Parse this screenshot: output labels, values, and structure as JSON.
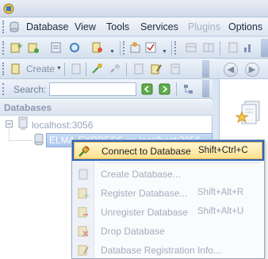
{
  "menubar": {
    "items": [
      {
        "label": "Database",
        "enabled": true
      },
      {
        "label": "View",
        "enabled": true
      },
      {
        "label": "Tools",
        "enabled": true
      },
      {
        "label": "Services",
        "enabled": true
      },
      {
        "label": "Plugins",
        "enabled": false
      },
      {
        "label": "Options",
        "enabled": true
      }
    ]
  },
  "toolbar": {
    "create_label": "Create",
    "search_label": "Search:",
    "search_value": ""
  },
  "databases_panel": {
    "header": "Databases",
    "server_node": "localhost:3056",
    "selected_db": "ELMA-EXPRESS on localhost:3056"
  },
  "context_menu": {
    "items": [
      {
        "label": "Connect to Database",
        "shortcut": "Shift+Ctrl+C",
        "enabled": true,
        "icon": "connect-plug-icon"
      },
      {
        "label": "Create Database...",
        "shortcut": "",
        "enabled": false,
        "icon": "create-database-icon"
      },
      {
        "label": "Register Database...",
        "shortcut": "Shift+Alt+R",
        "enabled": false,
        "icon": "register-database-icon"
      },
      {
        "label": "Unregister Database",
        "shortcut": "Shift+Alt+U",
        "enabled": false,
        "icon": "unregister-database-icon"
      },
      {
        "label": "Drop Database",
        "shortcut": "",
        "enabled": false,
        "icon": "drop-database-icon"
      },
      {
        "label": "Database Registration Info...",
        "shortcut": "",
        "enabled": false,
        "icon": "registration-info-icon"
      }
    ]
  },
  "colors": {
    "highlight": "#ffe18e",
    "highlight_border": "#2b63c4",
    "panel_bg": "#dbe6f4"
  }
}
